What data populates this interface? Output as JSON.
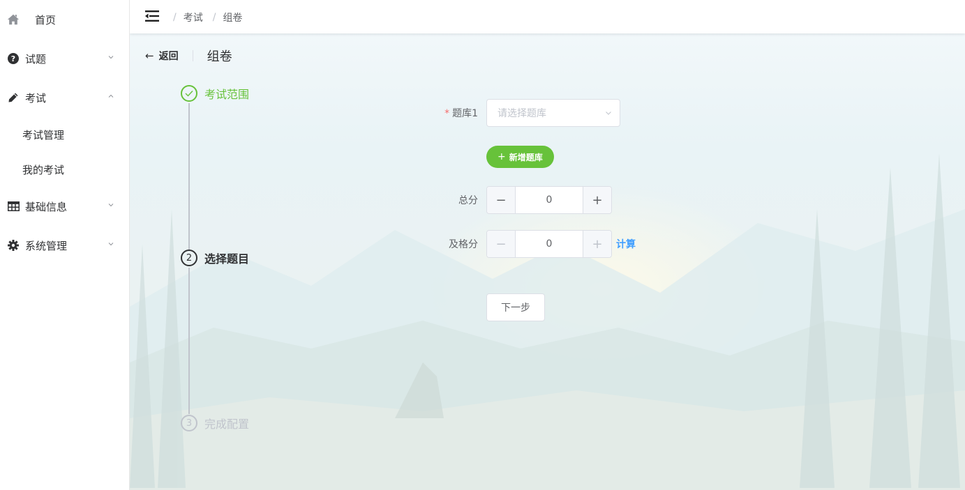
{
  "sidebar": {
    "items": [
      {
        "label": "首页",
        "icon": "home-icon"
      },
      {
        "label": "试题",
        "icon": "question-circle-icon"
      },
      {
        "label": "考试",
        "icon": "pencil-icon",
        "expanded": true,
        "children": [
          {
            "label": "考试管理"
          },
          {
            "label": "我的考试"
          }
        ]
      },
      {
        "label": "基础信息",
        "icon": "table-icon"
      },
      {
        "label": "系统管理",
        "icon": "gear-icon"
      }
    ]
  },
  "header": {
    "breadcrumb": [
      "考试",
      "组卷"
    ]
  },
  "page_header": {
    "back_label": "返回",
    "title": "组卷"
  },
  "steps": [
    {
      "number": "1",
      "title": "考试范围",
      "status": "finished"
    },
    {
      "number": "2",
      "title": "选择题目",
      "status": "active"
    },
    {
      "number": "3",
      "title": "完成配置",
      "status": "waiting"
    }
  ],
  "form": {
    "bank_label": "题库1",
    "bank_placeholder": "请选择题库",
    "add_bank_label": "新增题库",
    "total_label": "总分",
    "total_value": "0",
    "pass_label": "及格分",
    "pass_value": "0",
    "calc_label": "计算",
    "next_label": "下一步",
    "minus_symbol": "−",
    "plus_symbol": "+"
  },
  "colors": {
    "success": "#67c23a",
    "primary": "#409eff",
    "danger": "#f56c6c"
  }
}
